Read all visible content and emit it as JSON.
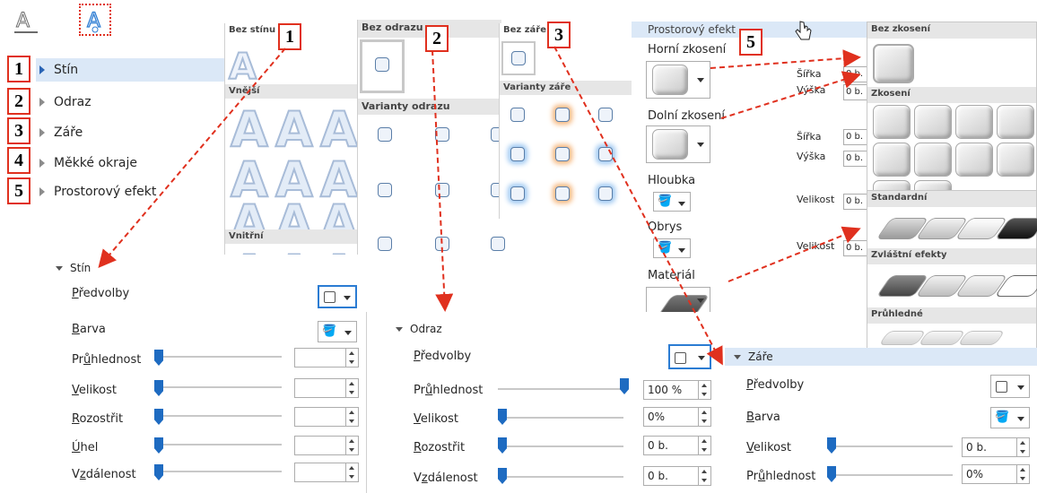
{
  "badges": [
    "1",
    "2",
    "3",
    "4",
    "5"
  ],
  "nav": {
    "items": [
      {
        "label": "Stín"
      },
      {
        "label": "Odraz"
      },
      {
        "label": "Záře"
      },
      {
        "label": "Měkké okraje"
      },
      {
        "label": "Prostorový efekt"
      }
    ]
  },
  "shadow_gallery": {
    "header_none": "Bez stínu",
    "header_outer": "Vnější",
    "header_inner": "Vnitřní"
  },
  "reflection_gallery": {
    "header_none": "Bez odrazu",
    "header_variants": "Varianty odrazu"
  },
  "glow_gallery": {
    "header_none": "Bez záře",
    "header_variants": "Varianty záře"
  },
  "shadow_panel": {
    "title": "Stín",
    "rows": [
      {
        "label": "Předvolby",
        "underline": "P"
      },
      {
        "label": "Barva",
        "underline": "B"
      },
      {
        "label": "Průhlednost",
        "underline": "ů"
      },
      {
        "label": "Velikost",
        "underline": "V"
      },
      {
        "label": "Rozostřit",
        "underline": "R"
      },
      {
        "label": "Úhel",
        "underline": "Ú"
      },
      {
        "label": "Vzdálenost",
        "underline": "z"
      }
    ]
  },
  "reflection_panel": {
    "title": "Odraz",
    "rows": [
      {
        "label": "Předvolby"
      },
      {
        "label": "Průhlednost",
        "value": "100 %"
      },
      {
        "label": "Velikost",
        "value": "0%"
      },
      {
        "label": "Rozostřit",
        "value": "0 b."
      },
      {
        "label": "Vzdálenost",
        "value": "0 b."
      }
    ]
  },
  "glow_panel": {
    "title": "Záře",
    "rows": [
      {
        "label": "Předvolby"
      },
      {
        "label": "Barva"
      },
      {
        "label": "Velikost",
        "value": "0 b."
      },
      {
        "label": "Průhlednost",
        "value": "0%"
      }
    ]
  },
  "bevel_panel": {
    "title": "Prostorový efekt",
    "top_bevel": "Horní zkosení",
    "bottom_bevel": "Dolní zkosení",
    "depth": "Hloubka",
    "contour": "Obrys",
    "material": "Materiál",
    "width_label": "Šířka",
    "height_label": "Výška",
    "size_label": "Velikost",
    "value": "0 b."
  },
  "bevel_gallery": {
    "header_none": "Bez zkosení",
    "header_bevel": "Zkosení"
  },
  "material_gallery": {
    "header_standard": "Standardní",
    "header_special": "Zvláštní efekty",
    "header_transparent": "Průhledné"
  },
  "colors": {
    "accent": "#2b7cd3",
    "callout": "#e0301e",
    "selected": "#dbe8f7"
  }
}
